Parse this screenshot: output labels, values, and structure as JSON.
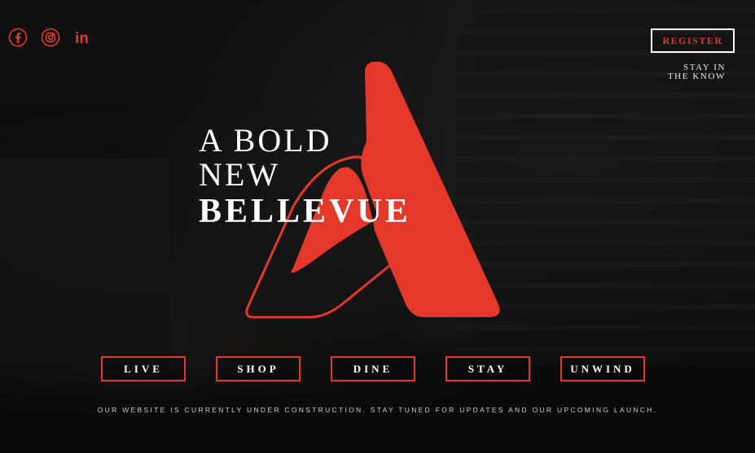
{
  "social": {
    "icons": [
      {
        "name": "facebook-icon",
        "glyph": "f"
      },
      {
        "name": "instagram-icon",
        "glyph": "ig"
      },
      {
        "name": "linkedin-icon",
        "glyph": "in"
      }
    ],
    "linkedin_text": "in"
  },
  "header": {
    "register_label": "REGISTER",
    "stay_line1": "STAY IN",
    "stay_line2": "THE KNOW"
  },
  "hero": {
    "line1": "A BOLD",
    "line2": "NEW",
    "line3": "BELLEVUE"
  },
  "nav": {
    "items": [
      {
        "label": "LIVE"
      },
      {
        "label": "SHOP"
      },
      {
        "label": "DINE"
      },
      {
        "label": "STAY"
      },
      {
        "label": "UNWIND"
      }
    ]
  },
  "footer": {
    "notice": "OUR WEBSITE IS CURRENTLY UNDER CONSTRUCTION. STAY TUNED FOR UPDATES AND OUR UPCOMING LAUNCH."
  },
  "colors": {
    "accent": "#e2392b",
    "text": "#ffffff",
    "background": "#0d0d0e"
  }
}
